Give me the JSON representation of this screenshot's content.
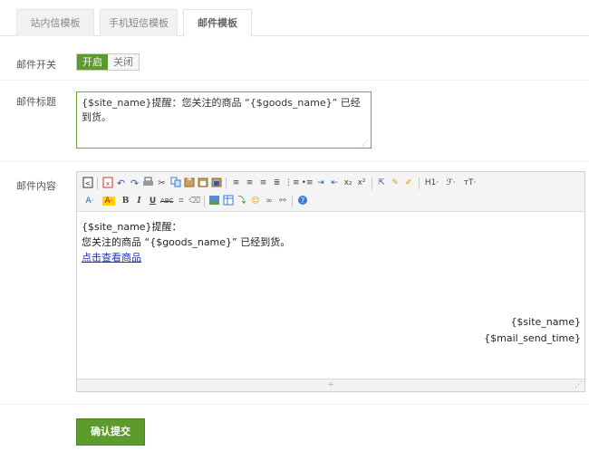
{
  "tabs": [
    {
      "label": "站内信模板"
    },
    {
      "label": "手机短信模板"
    },
    {
      "label": "邮件模板"
    }
  ],
  "fields": {
    "switch_label": "邮件开关",
    "switch_on": "开启",
    "switch_off": "关闭",
    "subject_label": "邮件标题",
    "subject_value": "{$site_name}提醒：您关注的商品 “{$goods_name}” 已经到货。",
    "content_label": "邮件内容"
  },
  "toolbar": {
    "row1": [
      "source",
      "preview",
      "undo",
      "redo",
      "print",
      "cut",
      "copy",
      "paste",
      "plainpaste",
      "wordpaste",
      "align-left",
      "align-center",
      "align-right",
      "justify",
      "ordered-list",
      "unordered-list",
      "indent",
      "outdent",
      "subscript",
      "superscript",
      "select-all",
      "clear-format",
      "quick-format",
      "heading",
      "font-family",
      "font-size"
    ],
    "row2": [
      "font-color",
      "background-color",
      "bold",
      "italic",
      "underline",
      "strikethrough",
      "line-height",
      "remove-format",
      "image",
      "table",
      "horizontal-rule",
      "emoticon",
      "link",
      "unlink",
      "about"
    ],
    "h1_label": "H1·",
    "ff_label": "ℱ·",
    "fs_label": "ᴛT·",
    "a_label": "A·",
    "bg_label": "A·"
  },
  "editor_content": {
    "line1": "{$site_name}提醒：",
    "line2": "您关注的商品 “{$goods_name}” 已经到货。",
    "link_text": "点击查看商品",
    "sig1": "{$site_name}",
    "sig2": "{$mail_send_time}"
  },
  "submit_label": "确认提交"
}
